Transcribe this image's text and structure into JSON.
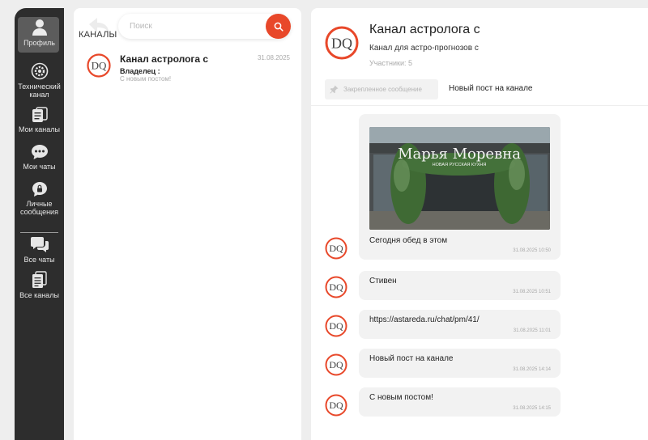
{
  "sidebar": {
    "items": [
      {
        "label": "Профиль",
        "icon": "person-icon"
      },
      {
        "label": "Технический канал",
        "icon": "gear-icon"
      },
      {
        "label": "Мои каналы",
        "icon": "channels-icon"
      },
      {
        "label": "Мои чаты",
        "icon": "chat-dots-icon"
      },
      {
        "label": "Личные сообщения",
        "icon": "lock-icon"
      },
      {
        "label": "Все чаты",
        "icon": "chats-icon"
      },
      {
        "label": "Все каналы",
        "icon": "documents-icon"
      }
    ]
  },
  "channels_panel": {
    "title": "КАНАЛЫ",
    "search_placeholder": "Поиск",
    "channels": [
      {
        "name": "Канал астролога с",
        "date": "31.08.2025",
        "owner_label": "Владелец :",
        "last_message": "С новым постом!",
        "avatar_text": "DQ"
      }
    ]
  },
  "chat": {
    "title": "Канал астролога с",
    "description": "Канал для астро-прогнозов с",
    "members": "Участники: 5",
    "avatar_text": "DQ",
    "pinned_label": "Закрепленное сообщение",
    "pinned_text": "Новый пост на канале",
    "photo_sign": "Марья Моревна",
    "photo_subsign": "НОВАЯ РУССКАЯ КУХНЯ",
    "messages": [
      {
        "text": "Сегодня обед в этом",
        "time": "31.08.2025 10:50",
        "has_image": true
      },
      {
        "text": "Стивен",
        "time": "31.08.2025 10:51"
      },
      {
        "text": "https://astareda.ru/chat/pm/41/",
        "time": "31.08.2025 11:01"
      },
      {
        "text": "Новый пост на канале",
        "time": "31.08.2025 14:14"
      },
      {
        "text": "С новым постом!",
        "time": "31.08.2025 14:15"
      }
    ]
  },
  "colors": {
    "accent": "#e8482a",
    "sidebar_bg": "#2d2d2d",
    "page_bg": "#eeeeee",
    "bubble_bg": "#f2f2f2"
  }
}
